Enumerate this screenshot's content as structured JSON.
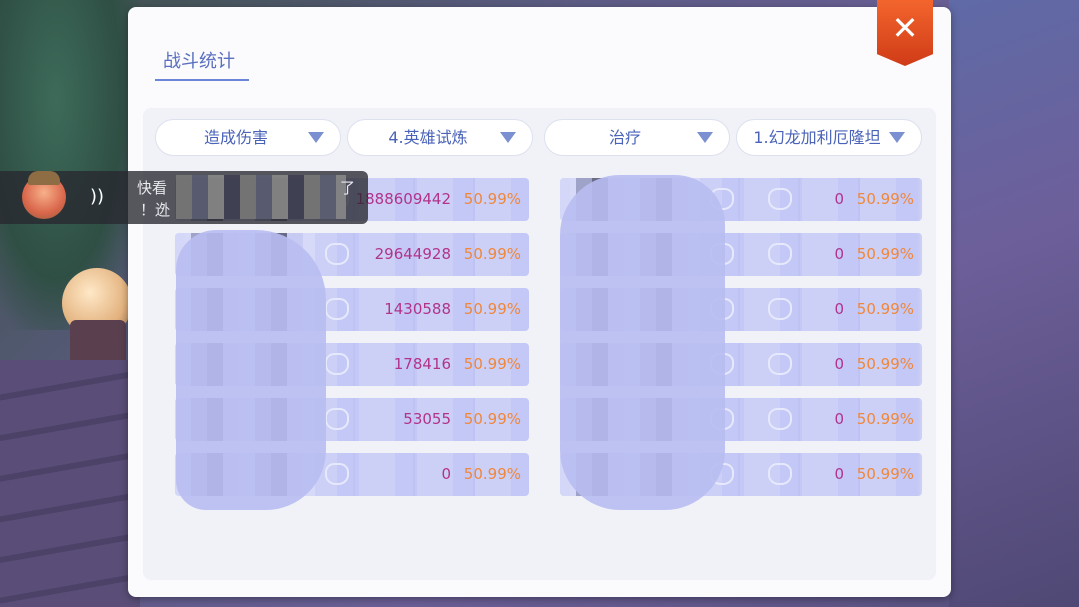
{
  "panel": {
    "title": "战斗统计",
    "close_icon": "close-icon"
  },
  "filters": [
    {
      "label": "造成伤害"
    },
    {
      "label": "4.英雄试炼"
    },
    {
      "label": "治疗"
    },
    {
      "label": "1.幻龙加利厄隆坦"
    }
  ],
  "damage_rows": [
    {
      "value": "1888609442",
      "percent": "50.99%"
    },
    {
      "value": "29644928",
      "percent": "50.99%"
    },
    {
      "value": "1430588",
      "percent": "50.99%"
    },
    {
      "value": "178416",
      "percent": "50.99%"
    },
    {
      "value": "53055",
      "percent": "50.99%"
    },
    {
      "value": "0",
      "percent": "50.99%"
    }
  ],
  "heal_rows": [
    {
      "value": "0",
      "percent": "50.99%"
    },
    {
      "value": "0",
      "percent": "50.99%"
    },
    {
      "value": "0",
      "percent": "50.99%"
    },
    {
      "value": "0",
      "percent": "50.99%"
    },
    {
      "value": "0",
      "percent": "50.99%"
    },
    {
      "value": "0",
      "percent": "50.99%"
    }
  ],
  "chat": {
    "line1": "快看",
    "line2": "！迯",
    "tail": "了",
    "signal_icon": "signal-icon"
  },
  "colors": {
    "accent": "#4a63b8",
    "value": "#b1338a",
    "percent": "#f0873a",
    "close": "#e5512a"
  }
}
